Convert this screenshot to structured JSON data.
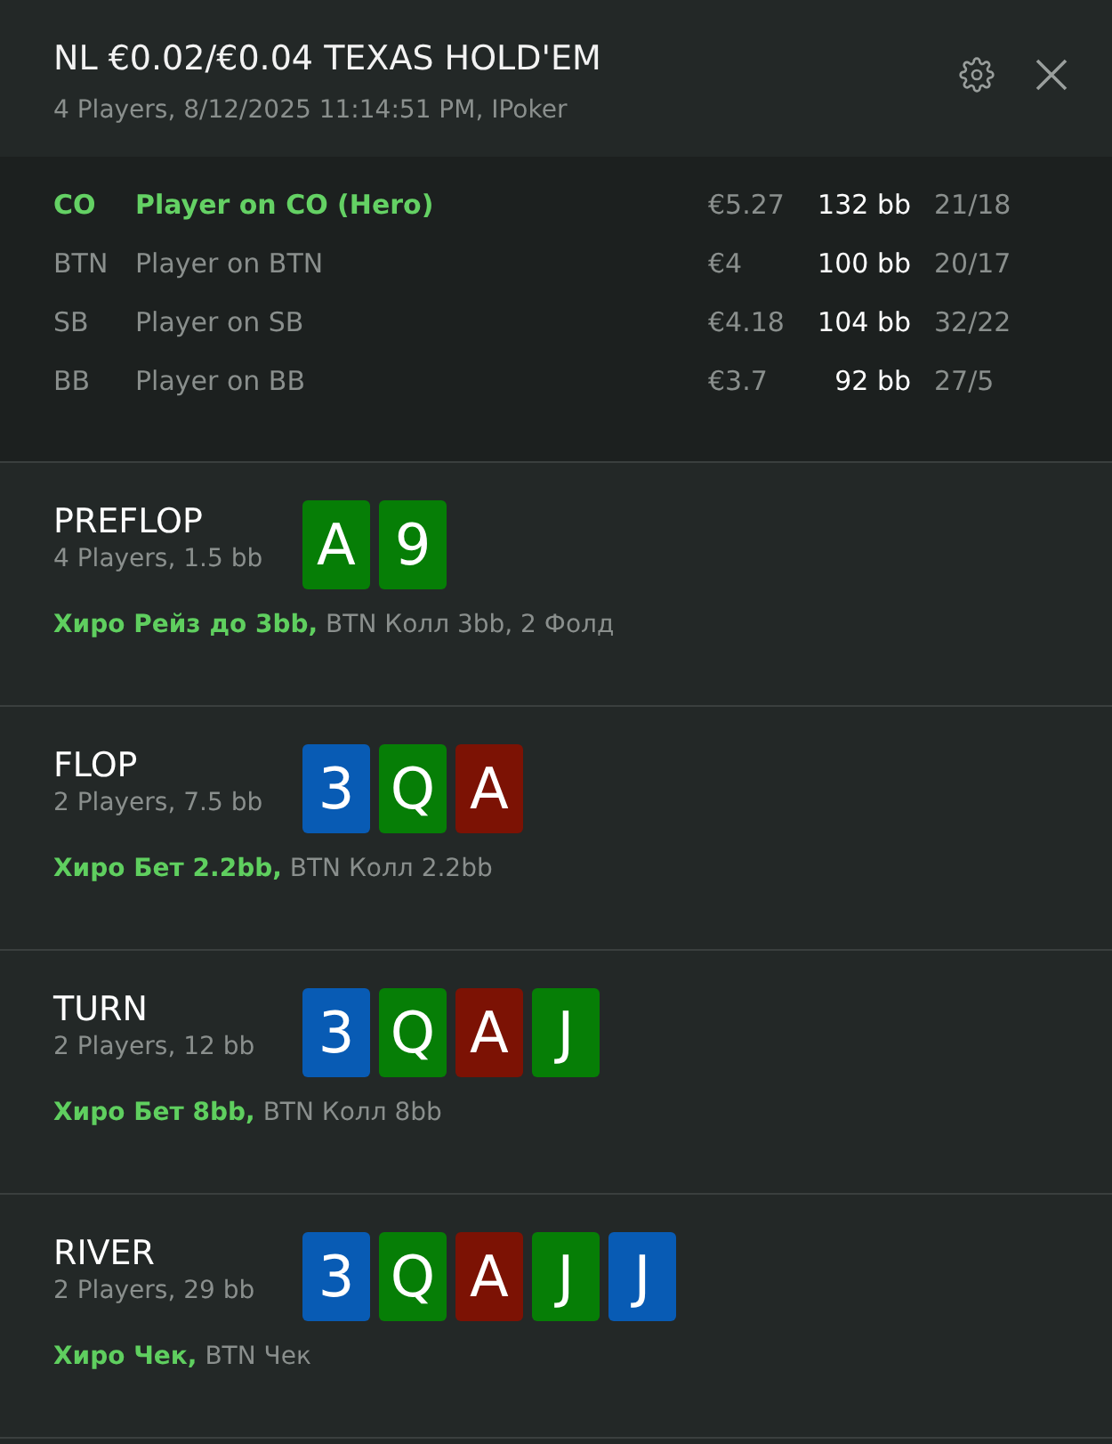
{
  "header": {
    "title": "NL €0.02/€0.04 TEXAS HOLD'EM",
    "subtitle": "4 Players, 8/12/2025 11:14:51 PM, IPoker"
  },
  "players": [
    {
      "position": "CO",
      "name": "Player on CO (Hero)",
      "hero": true,
      "money": "€5.27",
      "stack": "132 bb",
      "stats": "21/18"
    },
    {
      "position": "BTN",
      "name": "Player on BTN",
      "hero": false,
      "money": "€4",
      "stack": "100 bb",
      "stats": "20/17"
    },
    {
      "position": "SB",
      "name": "Player on SB",
      "hero": false,
      "money": "€4.18",
      "stack": "104 bb",
      "stats": "32/22"
    },
    {
      "position": "BB",
      "name": "Player on BB",
      "hero": false,
      "money": "€3.7",
      "stack": "92 bb",
      "stats": "27/5"
    }
  ],
  "streets": [
    {
      "name": "PREFLOP",
      "info": "4 Players, 1.5 bb",
      "cards": [
        {
          "rank": "A",
          "color": "#067e06"
        },
        {
          "rank": "9",
          "color": "#067e06"
        }
      ],
      "actions": "**Хиро Рейз до 3bb,** BTN Колл 3bb, 2 Фолд"
    },
    {
      "name": "FLOP",
      "info": "2 Players, 7.5 bb",
      "cards": [
        {
          "rank": "3",
          "color": "#085bb4"
        },
        {
          "rank": "Q",
          "color": "#067e06"
        },
        {
          "rank": "A",
          "color": "#7c1204"
        }
      ],
      "actions": "**Хиро Бет 2.2bb,** BTN Колл 2.2bb"
    },
    {
      "name": "TURN",
      "info": "2 Players, 12 bb",
      "cards": [
        {
          "rank": "3",
          "color": "#085bb4"
        },
        {
          "rank": "Q",
          "color": "#067e06"
        },
        {
          "rank": "A",
          "color": "#7c1204"
        },
        {
          "rank": "J",
          "color": "#067e06"
        }
      ],
      "actions": "**Хиро Бет 8bb,** BTN Колл 8bb"
    },
    {
      "name": "RIVER",
      "info": "2 Players, 29 bb",
      "cards": [
        {
          "rank": "3",
          "color": "#085bb4"
        },
        {
          "rank": "Q",
          "color": "#067e06"
        },
        {
          "rank": "A",
          "color": "#7c1204"
        },
        {
          "rank": "J",
          "color": "#067e06"
        },
        {
          "rank": "J",
          "color": "#085bb4"
        }
      ],
      "actions": "**Хиро Чек,** BTN Чек"
    }
  ]
}
